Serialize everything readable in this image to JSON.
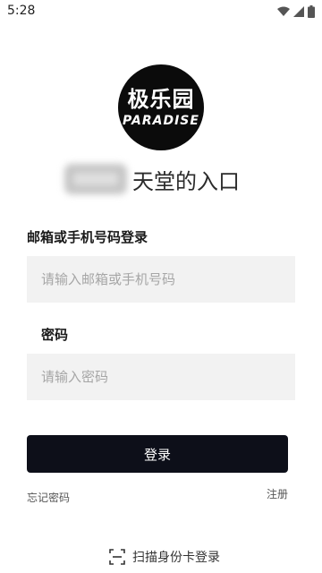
{
  "status_bar": {
    "time": "5:28"
  },
  "logo": {
    "cn": "极乐园",
    "en": "PARADISE"
  },
  "tagline": {
    "text": "天堂的入口"
  },
  "form": {
    "account_label": "邮箱或手机号码登录",
    "account_placeholder": "请输入邮箱或手机号码",
    "password_label": "密码",
    "password_placeholder": "请输入密码",
    "login_button": "登录"
  },
  "links": {
    "forgot_password": "忘记密码",
    "register": "注册"
  },
  "scan": {
    "label": "扫描身份卡登录"
  },
  "colors": {
    "primary": "#0d0f19",
    "field_bg": "#f2f2f2",
    "logo_bg": "#0b0b0b"
  }
}
